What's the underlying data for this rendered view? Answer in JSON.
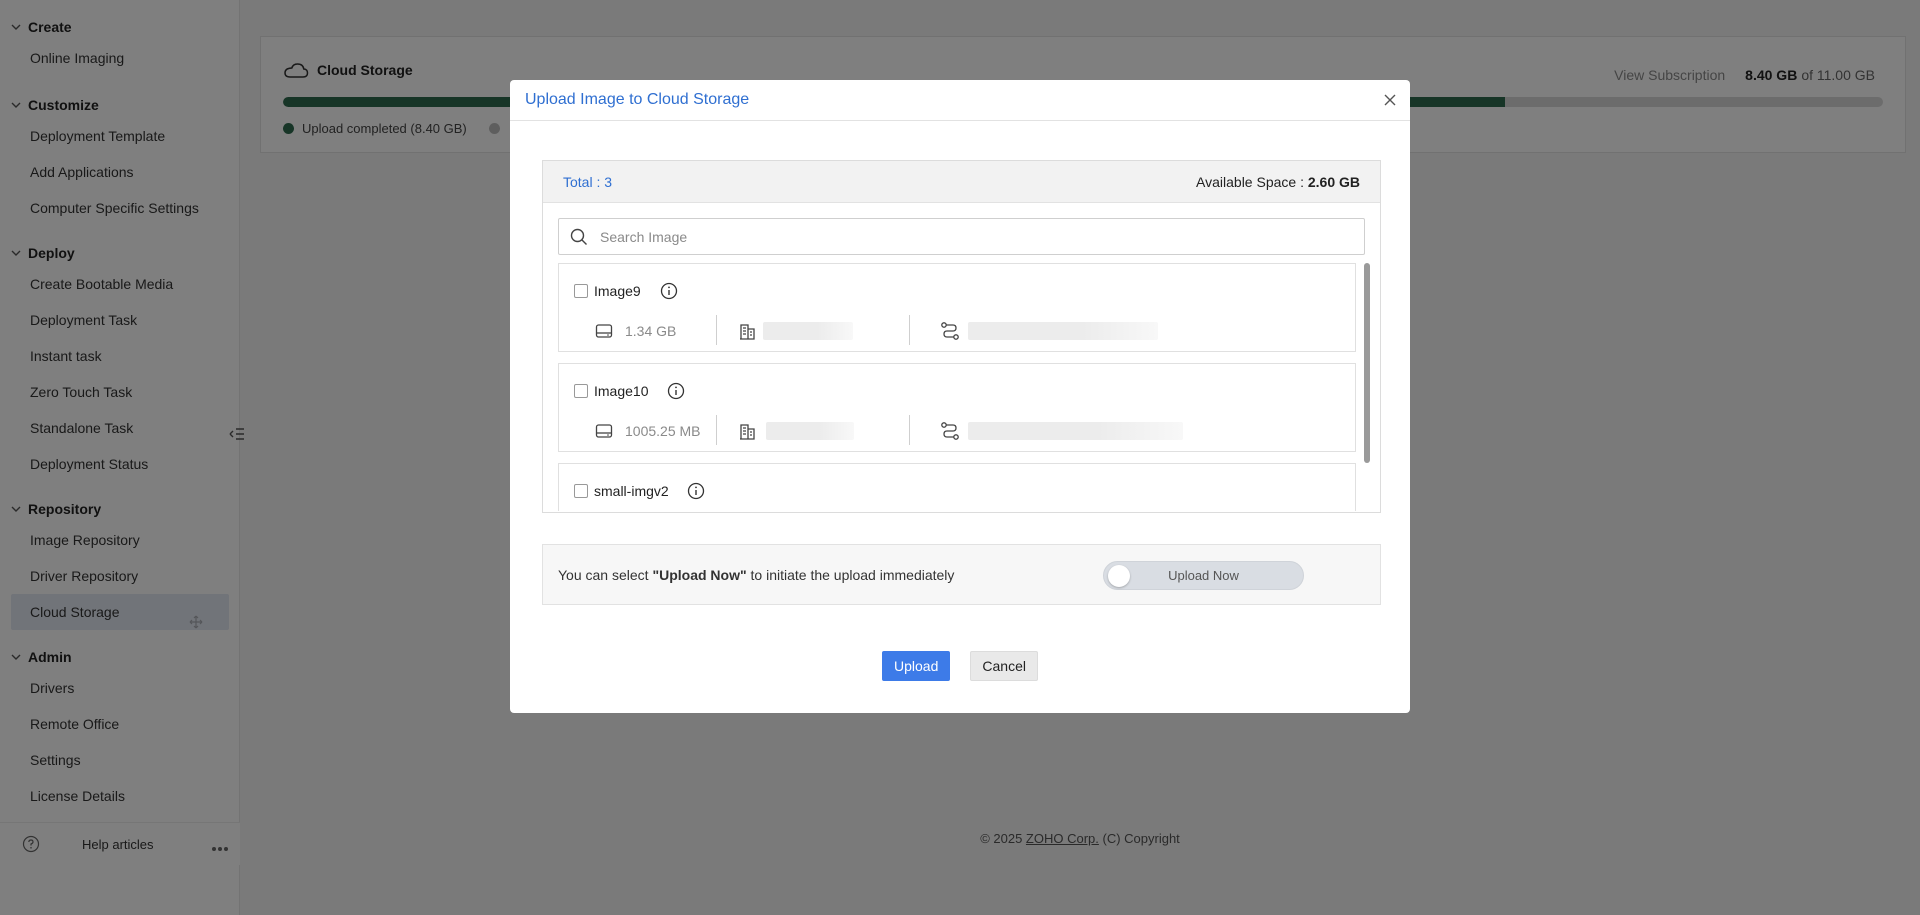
{
  "sidebar": {
    "sections": [
      {
        "title": "Create",
        "items": [
          "Online Imaging"
        ]
      },
      {
        "title": "Customize",
        "items": [
          "Deployment Template",
          "Add Applications",
          "Computer Specific Settings"
        ]
      },
      {
        "title": "Deploy",
        "items": [
          "Create Bootable Media",
          "Deployment Task",
          "Instant task",
          "Zero Touch Task",
          "Standalone Task",
          "Deployment Status"
        ]
      },
      {
        "title": "Repository",
        "items": [
          "Image Repository",
          "Driver Repository",
          "Cloud Storage"
        ]
      },
      {
        "title": "Admin",
        "items": [
          "Drivers",
          "Remote Office",
          "Settings",
          "License Details"
        ]
      }
    ],
    "active_item": "Cloud Storage",
    "footer": {
      "help_label": "Help articles"
    }
  },
  "storage": {
    "title": "Cloud Storage",
    "view_subscription": "View Subscription",
    "used": "8.40 GB",
    "of_total": "of 11.00 GB",
    "used_fraction": 0.764,
    "legend_completed": "Upload completed (8.40 GB)",
    "colors": {
      "completed": "#2f6b4f",
      "remaining": "#d8d8d8"
    }
  },
  "footer": {
    "prefix": "© 2025 ",
    "company": "ZOHO Corp.",
    "suffix": " (C) Copyright"
  },
  "modal": {
    "title": "Upload Image to Cloud Storage",
    "total": "Total : 3",
    "available_label": "Available Space : ",
    "available_value": "2.60 GB",
    "search_placeholder": "Search Image",
    "images": [
      {
        "name": "Image9",
        "size": "1.34 GB"
      },
      {
        "name": "Image10",
        "size": "1005.25 MB"
      },
      {
        "name": "small-imgv2",
        "size": ""
      }
    ],
    "upload_now_text_pre": "You can select ",
    "upload_now_text_bold": "\"Upload Now\"",
    "upload_now_text_post": " to initiate the upload immediately",
    "toggle_label": "Upload Now",
    "toggle_on": false,
    "upload_button": "Upload",
    "cancel_button": "Cancel",
    "accent": "#2f6fd1"
  }
}
